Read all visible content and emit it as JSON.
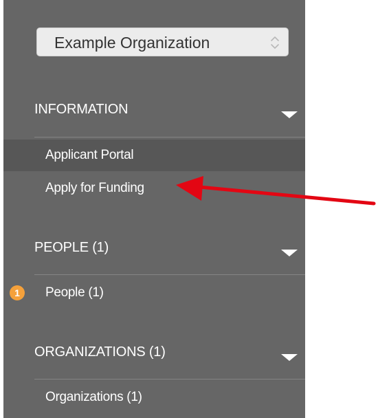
{
  "org_selector": {
    "value": "Example Organization",
    "icon": "updown-chevrons-icon"
  },
  "sections": {
    "information": {
      "title": "INFORMATION",
      "items": [
        "Applicant Portal",
        "Apply for Funding"
      ]
    },
    "people": {
      "title": "PEOPLE (1)",
      "items": [
        "People  (1)"
      ],
      "badge": "1"
    },
    "organizations": {
      "title": "ORGANIZATIONS (1)",
      "items": [
        "Organizations  (1)"
      ]
    }
  },
  "colors": {
    "sidebar_bg": "#666666",
    "active_item_bg": "#575757",
    "badge": "#f5a13b",
    "annotation_arrow": "#e30613"
  }
}
